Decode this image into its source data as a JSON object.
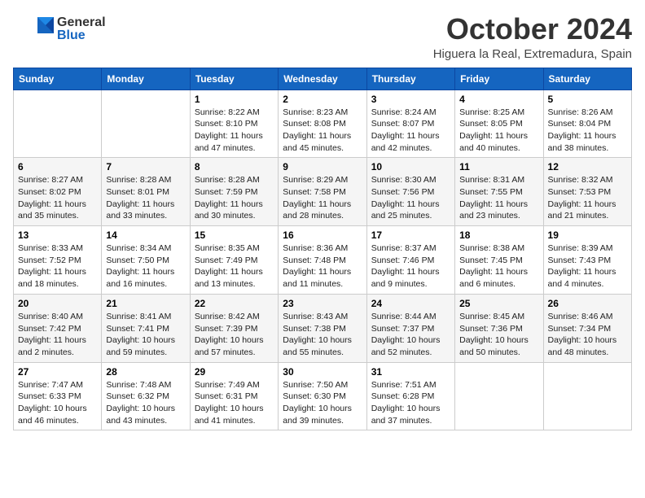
{
  "header": {
    "logo": {
      "general": "General",
      "blue": "Blue"
    },
    "title": "October 2024",
    "location": "Higuera la Real, Extremadura, Spain"
  },
  "weekdays": [
    "Sunday",
    "Monday",
    "Tuesday",
    "Wednesday",
    "Thursday",
    "Friday",
    "Saturday"
  ],
  "weeks": [
    [
      {
        "day": "",
        "info": ""
      },
      {
        "day": "",
        "info": ""
      },
      {
        "day": "1",
        "info": "Sunrise: 8:22 AM\nSunset: 8:10 PM\nDaylight: 11 hours and 47 minutes."
      },
      {
        "day": "2",
        "info": "Sunrise: 8:23 AM\nSunset: 8:08 PM\nDaylight: 11 hours and 45 minutes."
      },
      {
        "day": "3",
        "info": "Sunrise: 8:24 AM\nSunset: 8:07 PM\nDaylight: 11 hours and 42 minutes."
      },
      {
        "day": "4",
        "info": "Sunrise: 8:25 AM\nSunset: 8:05 PM\nDaylight: 11 hours and 40 minutes."
      },
      {
        "day": "5",
        "info": "Sunrise: 8:26 AM\nSunset: 8:04 PM\nDaylight: 11 hours and 38 minutes."
      }
    ],
    [
      {
        "day": "6",
        "info": "Sunrise: 8:27 AM\nSunset: 8:02 PM\nDaylight: 11 hours and 35 minutes."
      },
      {
        "day": "7",
        "info": "Sunrise: 8:28 AM\nSunset: 8:01 PM\nDaylight: 11 hours and 33 minutes."
      },
      {
        "day": "8",
        "info": "Sunrise: 8:28 AM\nSunset: 7:59 PM\nDaylight: 11 hours and 30 minutes."
      },
      {
        "day": "9",
        "info": "Sunrise: 8:29 AM\nSunset: 7:58 PM\nDaylight: 11 hours and 28 minutes."
      },
      {
        "day": "10",
        "info": "Sunrise: 8:30 AM\nSunset: 7:56 PM\nDaylight: 11 hours and 25 minutes."
      },
      {
        "day": "11",
        "info": "Sunrise: 8:31 AM\nSunset: 7:55 PM\nDaylight: 11 hours and 23 minutes."
      },
      {
        "day": "12",
        "info": "Sunrise: 8:32 AM\nSunset: 7:53 PM\nDaylight: 11 hours and 21 minutes."
      }
    ],
    [
      {
        "day": "13",
        "info": "Sunrise: 8:33 AM\nSunset: 7:52 PM\nDaylight: 11 hours and 18 minutes."
      },
      {
        "day": "14",
        "info": "Sunrise: 8:34 AM\nSunset: 7:50 PM\nDaylight: 11 hours and 16 minutes."
      },
      {
        "day": "15",
        "info": "Sunrise: 8:35 AM\nSunset: 7:49 PM\nDaylight: 11 hours and 13 minutes."
      },
      {
        "day": "16",
        "info": "Sunrise: 8:36 AM\nSunset: 7:48 PM\nDaylight: 11 hours and 11 minutes."
      },
      {
        "day": "17",
        "info": "Sunrise: 8:37 AM\nSunset: 7:46 PM\nDaylight: 11 hours and 9 minutes."
      },
      {
        "day": "18",
        "info": "Sunrise: 8:38 AM\nSunset: 7:45 PM\nDaylight: 11 hours and 6 minutes."
      },
      {
        "day": "19",
        "info": "Sunrise: 8:39 AM\nSunset: 7:43 PM\nDaylight: 11 hours and 4 minutes."
      }
    ],
    [
      {
        "day": "20",
        "info": "Sunrise: 8:40 AM\nSunset: 7:42 PM\nDaylight: 11 hours and 2 minutes."
      },
      {
        "day": "21",
        "info": "Sunrise: 8:41 AM\nSunset: 7:41 PM\nDaylight: 10 hours and 59 minutes."
      },
      {
        "day": "22",
        "info": "Sunrise: 8:42 AM\nSunset: 7:39 PM\nDaylight: 10 hours and 57 minutes."
      },
      {
        "day": "23",
        "info": "Sunrise: 8:43 AM\nSunset: 7:38 PM\nDaylight: 10 hours and 55 minutes."
      },
      {
        "day": "24",
        "info": "Sunrise: 8:44 AM\nSunset: 7:37 PM\nDaylight: 10 hours and 52 minutes."
      },
      {
        "day": "25",
        "info": "Sunrise: 8:45 AM\nSunset: 7:36 PM\nDaylight: 10 hours and 50 minutes."
      },
      {
        "day": "26",
        "info": "Sunrise: 8:46 AM\nSunset: 7:34 PM\nDaylight: 10 hours and 48 minutes."
      }
    ],
    [
      {
        "day": "27",
        "info": "Sunrise: 7:47 AM\nSunset: 6:33 PM\nDaylight: 10 hours and 46 minutes."
      },
      {
        "day": "28",
        "info": "Sunrise: 7:48 AM\nSunset: 6:32 PM\nDaylight: 10 hours and 43 minutes."
      },
      {
        "day": "29",
        "info": "Sunrise: 7:49 AM\nSunset: 6:31 PM\nDaylight: 10 hours and 41 minutes."
      },
      {
        "day": "30",
        "info": "Sunrise: 7:50 AM\nSunset: 6:30 PM\nDaylight: 10 hours and 39 minutes."
      },
      {
        "day": "31",
        "info": "Sunrise: 7:51 AM\nSunset: 6:28 PM\nDaylight: 10 hours and 37 minutes."
      },
      {
        "day": "",
        "info": ""
      },
      {
        "day": "",
        "info": ""
      }
    ]
  ]
}
